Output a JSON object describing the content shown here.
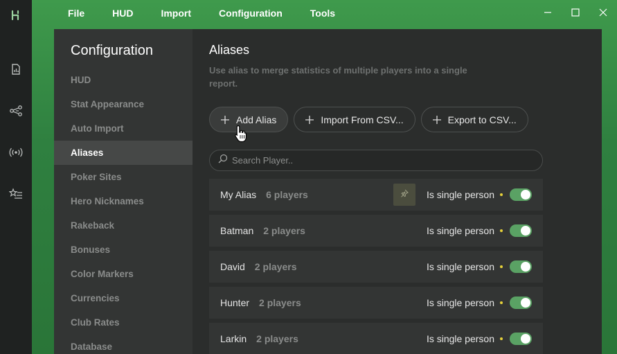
{
  "menu": {
    "items": [
      "File",
      "HUD",
      "Import",
      "Configuration",
      "Tools"
    ]
  },
  "rail": {
    "icons": [
      "logo-icon",
      "report-icon",
      "share-network-icon",
      "broadcast-icon",
      "starred-list-icon"
    ]
  },
  "sidebar": {
    "title": "Configuration",
    "items": [
      {
        "label": "HUD"
      },
      {
        "label": "Stat Appearance"
      },
      {
        "label": "Auto Import"
      },
      {
        "label": "Aliases"
      },
      {
        "label": "Poker Sites"
      },
      {
        "label": "Hero Nicknames"
      },
      {
        "label": "Rakeback"
      },
      {
        "label": "Bonuses"
      },
      {
        "label": "Color Markers"
      },
      {
        "label": "Currencies"
      },
      {
        "label": "Club Rates"
      },
      {
        "label": "Database"
      }
    ],
    "active": "Aliases"
  },
  "content": {
    "title": "Aliases",
    "description": "Use alias to merge statistics of multiple players into a single report.",
    "buttons": {
      "add": "Add Alias",
      "import": "Import From CSV...",
      "export": "Export to CSV..."
    },
    "search": {
      "placeholder": "Search Player..",
      "value": ""
    }
  },
  "aliases": [
    {
      "name": "My Alias",
      "count": "6 players",
      "single_label": "Is single person",
      "single": true,
      "pinned": true
    },
    {
      "name": "Batman",
      "count": "2 players",
      "single_label": "Is single person",
      "single": true,
      "pinned": false
    },
    {
      "name": "David",
      "count": "2 players",
      "single_label": "Is single person",
      "single": true,
      "pinned": false
    },
    {
      "name": "Hunter",
      "count": "2 players",
      "single_label": "Is single person",
      "single": true,
      "pinned": false
    },
    {
      "name": "Larkin",
      "count": "2 players",
      "single_label": "Is single person",
      "single": true,
      "pinned": false
    }
  ],
  "colors": {
    "accent_green": "#5aa264",
    "dot_yellow": "#e7d23a",
    "backdrop_green": "#2f8040"
  }
}
